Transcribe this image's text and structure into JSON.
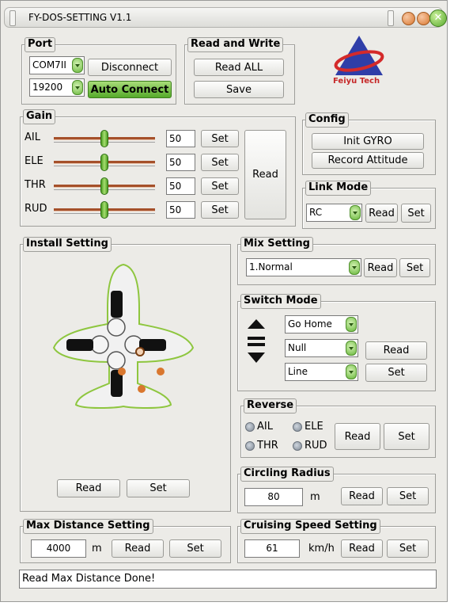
{
  "window": {
    "title": "FY-DOS-SETTING V1.1"
  },
  "port": {
    "legend": "Port",
    "com_value": "COM7II",
    "baud_value": "19200",
    "disconnect_label": "Disconnect",
    "auto_connect_label": "Auto Connect"
  },
  "read_write": {
    "legend": "Read and Write",
    "read_all_label": "Read ALL",
    "save_label": "Save"
  },
  "logo": {
    "text": "Feiyu Tech"
  },
  "gain": {
    "legend": "Gain",
    "read_label": "Read",
    "rows": [
      {
        "label": "AIL",
        "value": "50",
        "set_label": "Set",
        "level": 0.5
      },
      {
        "label": "ELE",
        "value": "50",
        "set_label": "Set",
        "level": 0.5
      },
      {
        "label": "THR",
        "value": "50",
        "set_label": "Set",
        "level": 0.5
      },
      {
        "label": "RUD",
        "value": "50",
        "set_label": "Set",
        "level": 0.5
      }
    ]
  },
  "config": {
    "legend": "Config",
    "init_gyro_label": "Init GYRO",
    "record_attitude_label": "Record Attitude"
  },
  "link_mode": {
    "legend": "Link Mode",
    "value": "RC",
    "read_label": "Read",
    "set_label": "Set"
  },
  "install": {
    "legend": "Install Setting",
    "read_label": "Read",
    "set_label": "Set"
  },
  "mix": {
    "legend": "Mix Setting",
    "value": "1.Normal",
    "read_label": "Read",
    "set_label": "Set"
  },
  "switch_mode": {
    "legend": "Switch Mode",
    "up_value": "Go Home",
    "mid_value": "Null",
    "down_value": "Line",
    "read_label": "Read",
    "set_label": "Set"
  },
  "reverse": {
    "legend": "Reverse",
    "ail_label": "AIL",
    "ele_label": "ELE",
    "thr_label": "THR",
    "rud_label": "RUD",
    "read_label": "Read",
    "set_label": "Set"
  },
  "circling": {
    "legend": "Circling Radius",
    "value": "80",
    "unit": "m",
    "read_label": "Read",
    "set_label": "Set"
  },
  "max_distance": {
    "legend": "Max Distance Setting",
    "value": "4000",
    "unit": "m",
    "read_label": "Read",
    "set_label": "Set"
  },
  "cruising": {
    "legend": "Cruising Speed Setting",
    "value": "61",
    "unit": "km/h",
    "read_label": "Read",
    "set_label": "Set"
  },
  "status": {
    "text": "Read Max Distance Done!"
  },
  "colors": {
    "accent_green": "#55aa2a",
    "logo_blue": "#2f3ea8",
    "logo_red": "#d42a2a",
    "window_bg": "#ecebe7"
  }
}
